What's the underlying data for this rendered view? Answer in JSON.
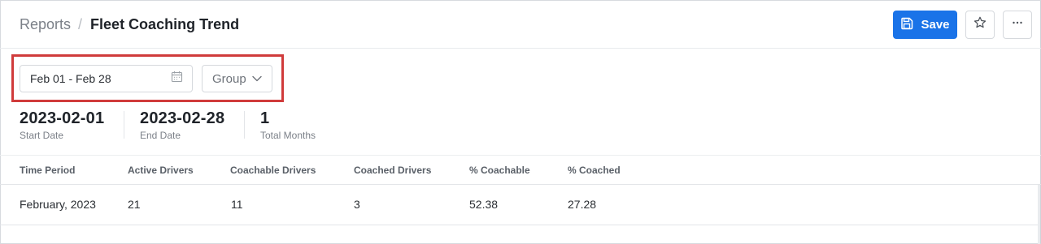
{
  "header": {
    "breadcrumb_root": "Reports",
    "breadcrumb_separator": "/",
    "title": "Fleet Coaching Trend",
    "save_label": "Save",
    "save_icon": "floppy-disk-icon",
    "favorite_icon": "star-icon",
    "more_icon": "ellipsis-icon"
  },
  "filters": {
    "date_range": "Feb 01 - Feb 28",
    "date_icon": "calendar-icon",
    "group_label": "Group",
    "group_icon": "chevron-down-icon",
    "highlight_color": "#d03b3b"
  },
  "summary": {
    "start_date": {
      "value": "2023-02-01",
      "label": "Start Date"
    },
    "end_date": {
      "value": "2023-02-28",
      "label": "End Date"
    },
    "total_months": {
      "value": "1",
      "label": "Total Months"
    }
  },
  "table": {
    "columns": [
      "Time Period",
      "Active Drivers",
      "Coachable Drivers",
      "Coached Drivers",
      "% Coachable",
      "% Coached"
    ],
    "rows": [
      [
        "February, 2023",
        "21",
        "11",
        "3",
        "52.38",
        "27.28"
      ]
    ]
  },
  "colors": {
    "accent": "#1a73e8"
  }
}
